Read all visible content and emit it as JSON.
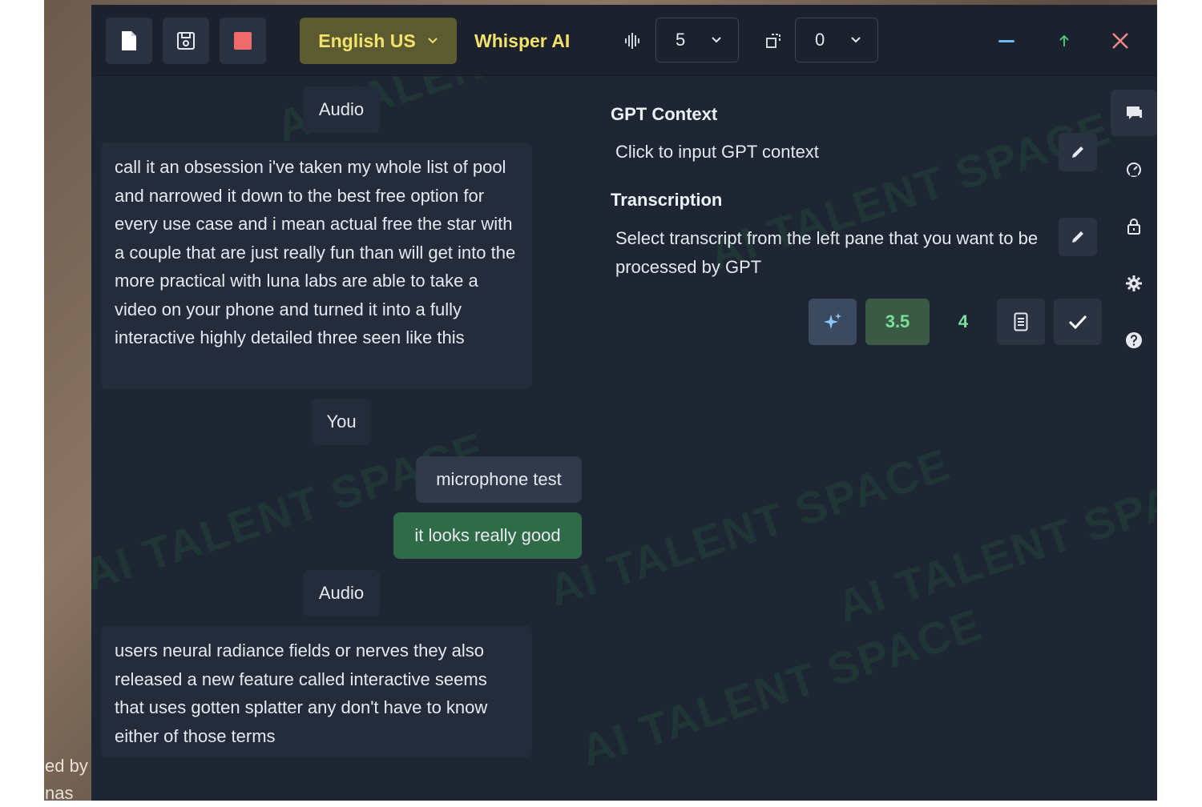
{
  "background": {
    "caption_lines": [
      "ed by (",
      "nas"
    ]
  },
  "toolbar": {
    "new_icon": "file-icon",
    "save_icon": "save-icon",
    "record_icon": "stop-square-icon",
    "language": "English US",
    "engine": "Whisper AI",
    "audio_level_select": "5",
    "offset_select": "0",
    "minimize_icon": "minimize-icon",
    "up_icon": "arrow-up-icon",
    "close_icon": "close-icon"
  },
  "transcript": {
    "audio_label_1": "Audio",
    "audio_text_1": "call it an obsession i've taken my whole list of pool and narrowed it down to the best free option for every use case and i mean actual free the star with a couple that are just really fun than will get into the more practical with luna labs are able to take a video on your phone and turned it into a fully interactive highly detailed three seen like this",
    "you_label": "You",
    "you_msg_1": "microphone test",
    "you_msg_2": "it looks really good",
    "audio_label_2": "Audio",
    "audio_text_2": "users neural radiance fields or nerves they also released a new feature called interactive seems that uses gotten splatter any don't have to know either of those terms"
  },
  "gpt_panel": {
    "context_title": "GPT Context",
    "context_placeholder": "Click to input GPT context",
    "transcription_title": "Transcription",
    "transcription_text": "Select transcript from the left pane that you want to be processed by GPT",
    "model_35": "3.5",
    "model_4": "4"
  },
  "side_rail": {
    "icons": [
      "chat-icon",
      "speedometer-icon",
      "lock-icon",
      "settings-icon",
      "help-icon"
    ]
  },
  "watermark": {
    "text": "AI TALENT SPACE"
  },
  "colors": {
    "app_bg": "#1e2533",
    "toolbar_bg": "#1b212d",
    "accent_yellow": "#f3e26b",
    "language_bg": "#5c5a30",
    "record_red": "#ef6b6b",
    "bubble_green": "#2f6b47",
    "model_green": "#79e09a",
    "minimize_blue": "#6fb7f5",
    "up_green": "#4fc37a",
    "close_red": "#f08a8a"
  }
}
